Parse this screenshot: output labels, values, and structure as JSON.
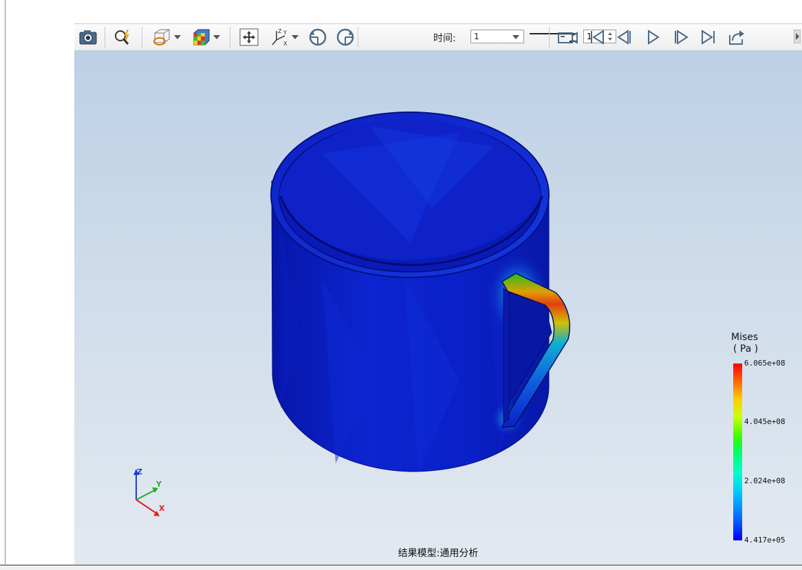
{
  "toolbar": {
    "time_label": "时间:",
    "time_select_value": "1",
    "frame_spin_value": "1",
    "buttons": [
      "camera-icon",
      "query-icon",
      "display-mode-icon",
      "color-map-icon",
      "fit-view-icon",
      "axes-view-icon",
      "rotate-ccw-icon",
      "rotate-cw-icon",
      "record-icon",
      "first-frame-icon",
      "prev-frame-icon",
      "play-icon",
      "next-frame-icon",
      "last-frame-icon",
      "export-icon"
    ]
  },
  "legend": {
    "title": "Mises",
    "unit": "( Pa )",
    "values": [
      "6.065e+08",
      "4.045e+08",
      "2.024e+08",
      "4.417e+05"
    ],
    "colors": [
      "#ff0000",
      "#33ff00",
      "#00ccff",
      "#0000ff"
    ]
  },
  "triad": {
    "z": "Z",
    "y": "Y",
    "x": "X"
  },
  "model_label": "结果模型:通用分析",
  "colors": {
    "background_top": "#bcd0e6",
    "background_bottom": "#e3e9f0",
    "mug_color": "#0a1ccf"
  }
}
